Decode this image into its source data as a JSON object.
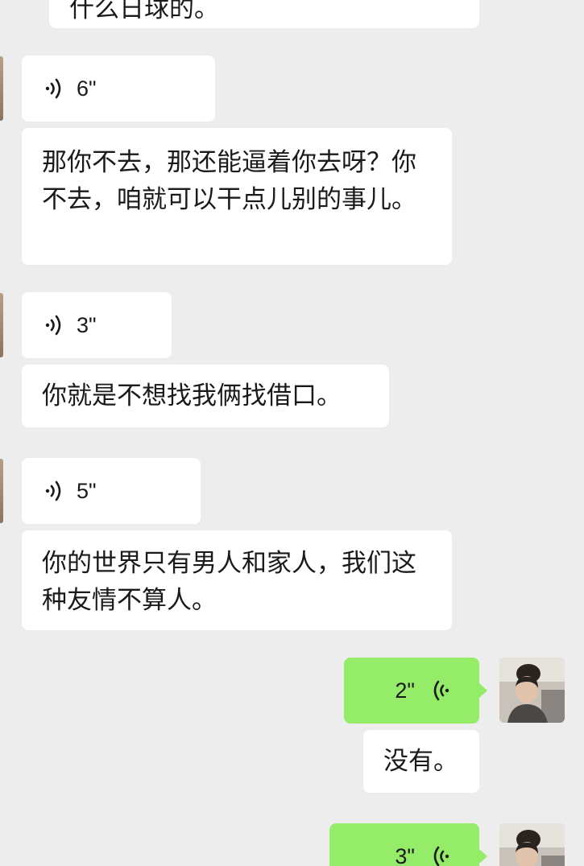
{
  "messages": [
    {
      "id": "m0",
      "side": "left",
      "type": "text",
      "text": "什么日球的。"
    },
    {
      "id": "m1",
      "side": "left",
      "type": "voice",
      "duration": "6\""
    },
    {
      "id": "m2",
      "side": "left",
      "type": "text",
      "text": "那你不去，那还能逼着你去呀？你不去，咱就可以干点儿别的事儿。"
    },
    {
      "id": "m3",
      "side": "left",
      "type": "voice",
      "duration": "3\""
    },
    {
      "id": "m4",
      "side": "left",
      "type": "text",
      "text": "你就是不想找我俩找借口。"
    },
    {
      "id": "m5",
      "side": "left",
      "type": "voice",
      "duration": "5\""
    },
    {
      "id": "m6",
      "side": "left",
      "type": "text",
      "text": "你的世界只有男人和家人，我们这种友情不算人。"
    },
    {
      "id": "m7",
      "side": "right",
      "type": "voice",
      "duration": "2\""
    },
    {
      "id": "m8",
      "side": "right",
      "type": "text",
      "text": "没有。"
    },
    {
      "id": "m9",
      "side": "right",
      "type": "voice",
      "duration": "3\""
    }
  ],
  "colors": {
    "background": "#ededed",
    "incoming_bubble": "#ffffff",
    "outgoing_bubble": "#95ec69"
  },
  "icons": {
    "voice_incoming": "voice-wave-icon",
    "voice_outgoing": "voice-wave-icon"
  }
}
